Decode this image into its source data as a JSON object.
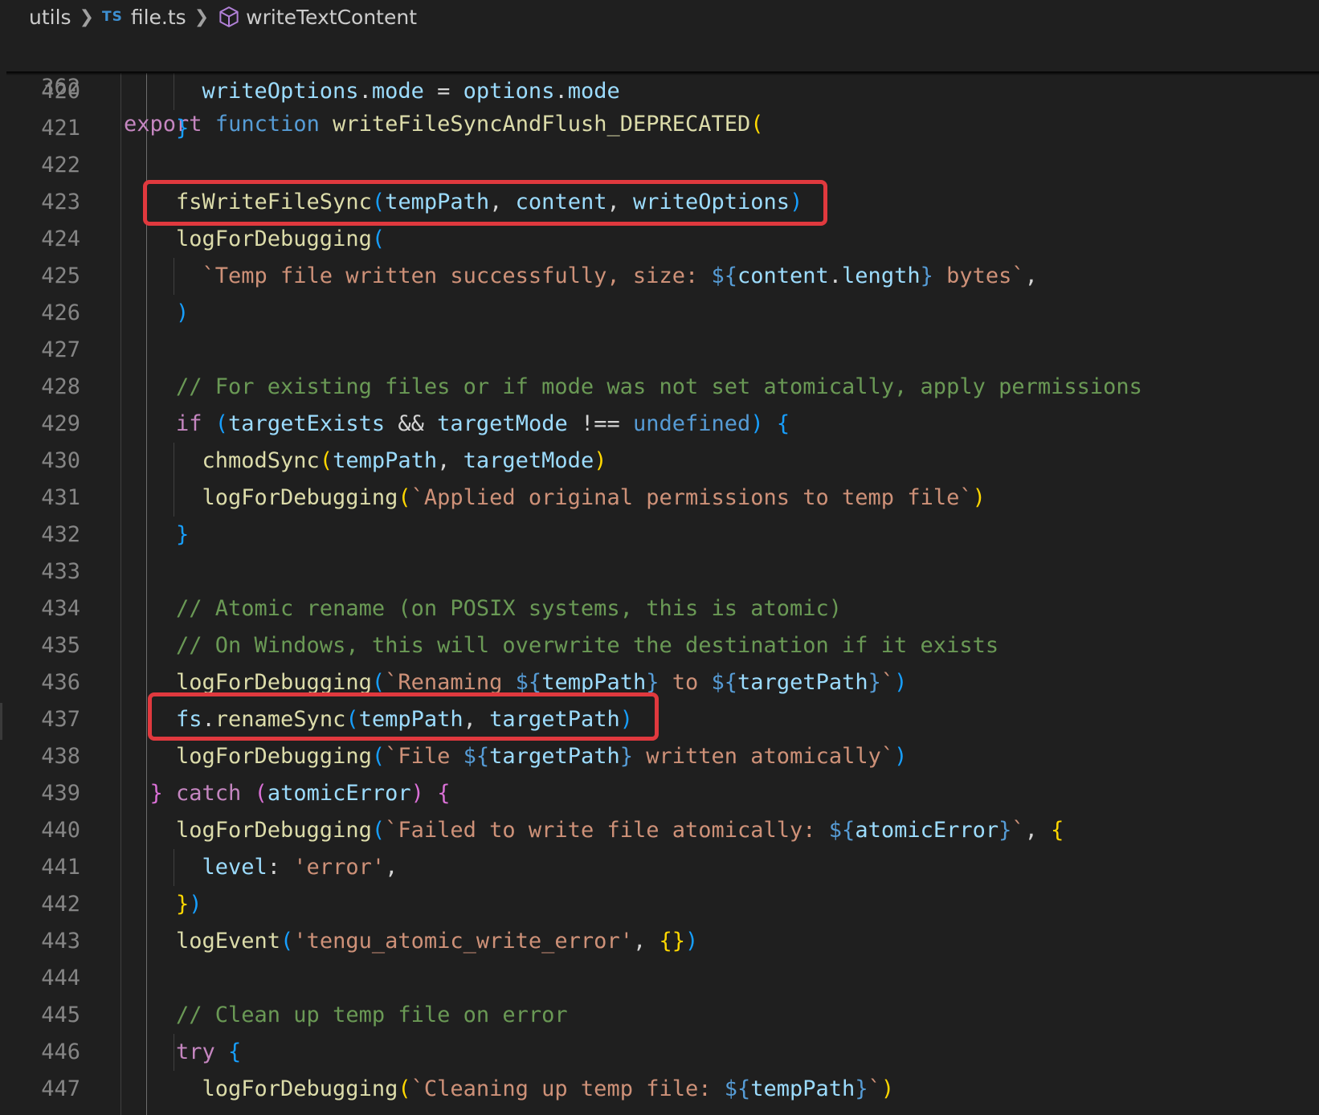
{
  "breadcrumb": {
    "folder": "utils",
    "language_badge": "TS",
    "file": "file.ts",
    "symbol": "writeTextContent"
  },
  "sticky": {
    "line_number": "362",
    "tokens": [
      {
        "t": "export",
        "c": "kw"
      },
      {
        "t": " ",
        "c": "op"
      },
      {
        "t": "function",
        "c": "kw2"
      },
      {
        "t": " ",
        "c": "op"
      },
      {
        "t": "writeFileSyncAndFlush_DEPRECATED",
        "c": "fn"
      },
      {
        "t": "(",
        "c": "p1"
      }
    ]
  },
  "lines": [
    {
      "n": "420",
      "indent": 3,
      "tokens": [
        {
          "t": "writeOptions",
          "c": "var"
        },
        {
          "t": ".",
          "c": "op"
        },
        {
          "t": "mode",
          "c": "prop"
        },
        {
          "t": " = ",
          "c": "op"
        },
        {
          "t": "options",
          "c": "var"
        },
        {
          "t": ".",
          "c": "op"
        },
        {
          "t": "mode",
          "c": "prop"
        }
      ]
    },
    {
      "n": "421",
      "indent": 2,
      "tokens": [
        {
          "t": "}",
          "c": "p3"
        }
      ]
    },
    {
      "n": "422",
      "indent": 0,
      "tokens": []
    },
    {
      "n": "423",
      "indent": 2,
      "tokens": [
        {
          "t": "fsWriteFileSync",
          "c": "fn"
        },
        {
          "t": "(",
          "c": "p3"
        },
        {
          "t": "tempPath",
          "c": "var"
        },
        {
          "t": ", ",
          "c": "op"
        },
        {
          "t": "content",
          "c": "var"
        },
        {
          "t": ", ",
          "c": "op"
        },
        {
          "t": "writeOptions",
          "c": "var"
        },
        {
          "t": ")",
          "c": "p3"
        }
      ]
    },
    {
      "n": "424",
      "indent": 2,
      "tokens": [
        {
          "t": "logForDebugging",
          "c": "fn"
        },
        {
          "t": "(",
          "c": "p3"
        }
      ]
    },
    {
      "n": "425",
      "indent": 3,
      "tokens": [
        {
          "t": "`Temp file written successfully, size: ",
          "c": "str"
        },
        {
          "t": "${",
          "c": "tpl"
        },
        {
          "t": "content",
          "c": "var"
        },
        {
          "t": ".",
          "c": "op"
        },
        {
          "t": "length",
          "c": "prop"
        },
        {
          "t": "}",
          "c": "tpl"
        },
        {
          "t": " bytes`",
          "c": "str"
        },
        {
          "t": ",",
          "c": "op"
        }
      ]
    },
    {
      "n": "426",
      "indent": 2,
      "tokens": [
        {
          "t": ")",
          "c": "p3"
        }
      ]
    },
    {
      "n": "427",
      "indent": 0,
      "tokens": []
    },
    {
      "n": "428",
      "indent": 2,
      "tokens": [
        {
          "t": "// For existing files or if mode was not set atomically, apply permissions",
          "c": "cmt"
        }
      ]
    },
    {
      "n": "429",
      "indent": 2,
      "tokens": [
        {
          "t": "if",
          "c": "kw"
        },
        {
          "t": " ",
          "c": "op"
        },
        {
          "t": "(",
          "c": "p3"
        },
        {
          "t": "targetExists",
          "c": "var"
        },
        {
          "t": " && ",
          "c": "op"
        },
        {
          "t": "targetMode",
          "c": "var"
        },
        {
          "t": " !== ",
          "c": "op"
        },
        {
          "t": "undefined",
          "c": "kw2"
        },
        {
          "t": ")",
          "c": "p3"
        },
        {
          "t": " ",
          "c": "op"
        },
        {
          "t": "{",
          "c": "p3"
        }
      ]
    },
    {
      "n": "430",
      "indent": 3,
      "tokens": [
        {
          "t": "chmodSync",
          "c": "fn"
        },
        {
          "t": "(",
          "c": "p1"
        },
        {
          "t": "tempPath",
          "c": "var"
        },
        {
          "t": ", ",
          "c": "op"
        },
        {
          "t": "targetMode",
          "c": "var"
        },
        {
          "t": ")",
          "c": "p1"
        }
      ]
    },
    {
      "n": "431",
      "indent": 3,
      "tokens": [
        {
          "t": "logForDebugging",
          "c": "fn"
        },
        {
          "t": "(",
          "c": "p1"
        },
        {
          "t": "`Applied original permissions to temp file`",
          "c": "str"
        },
        {
          "t": ")",
          "c": "p1"
        }
      ]
    },
    {
      "n": "432",
      "indent": 2,
      "tokens": [
        {
          "t": "}",
          "c": "p3"
        }
      ]
    },
    {
      "n": "433",
      "indent": 0,
      "tokens": []
    },
    {
      "n": "434",
      "indent": 2,
      "tokens": [
        {
          "t": "// Atomic rename (on POSIX systems, this is atomic)",
          "c": "cmt"
        }
      ]
    },
    {
      "n": "435",
      "indent": 2,
      "tokens": [
        {
          "t": "// On Windows, this will overwrite the destination if it exists",
          "c": "cmt"
        }
      ]
    },
    {
      "n": "436",
      "indent": 2,
      "tokens": [
        {
          "t": "logForDebugging",
          "c": "fn"
        },
        {
          "t": "(",
          "c": "p3"
        },
        {
          "t": "`Renaming ",
          "c": "str"
        },
        {
          "t": "${",
          "c": "tpl"
        },
        {
          "t": "tempPath",
          "c": "var"
        },
        {
          "t": "}",
          "c": "tpl"
        },
        {
          "t": " to ",
          "c": "str"
        },
        {
          "t": "${",
          "c": "tpl"
        },
        {
          "t": "targetPath",
          "c": "var"
        },
        {
          "t": "}",
          "c": "tpl"
        },
        {
          "t": "`",
          "c": "str"
        },
        {
          "t": ")",
          "c": "p3"
        }
      ]
    },
    {
      "n": "437",
      "indent": 2,
      "tokens": [
        {
          "t": "fs",
          "c": "var"
        },
        {
          "t": ".",
          "c": "op"
        },
        {
          "t": "renameSync",
          "c": "fn"
        },
        {
          "t": "(",
          "c": "p3"
        },
        {
          "t": "tempPath",
          "c": "var"
        },
        {
          "t": ", ",
          "c": "op"
        },
        {
          "t": "targetPath",
          "c": "var"
        },
        {
          "t": ")",
          "c": "p3"
        }
      ]
    },
    {
      "n": "438",
      "indent": 2,
      "tokens": [
        {
          "t": "logForDebugging",
          "c": "fn"
        },
        {
          "t": "(",
          "c": "p3"
        },
        {
          "t": "`File ",
          "c": "str"
        },
        {
          "t": "${",
          "c": "tpl"
        },
        {
          "t": "targetPath",
          "c": "var"
        },
        {
          "t": "}",
          "c": "tpl"
        },
        {
          "t": " written atomically`",
          "c": "str"
        },
        {
          "t": ")",
          "c": "p3"
        }
      ]
    },
    {
      "n": "439",
      "indent": 1,
      "tokens": [
        {
          "t": "}",
          "c": "p2"
        },
        {
          "t": " ",
          "c": "op"
        },
        {
          "t": "catch",
          "c": "kw"
        },
        {
          "t": " ",
          "c": "op"
        },
        {
          "t": "(",
          "c": "p2"
        },
        {
          "t": "atomicError",
          "c": "var"
        },
        {
          "t": ")",
          "c": "p2"
        },
        {
          "t": " ",
          "c": "op"
        },
        {
          "t": "{",
          "c": "p2"
        }
      ]
    },
    {
      "n": "440",
      "indent": 2,
      "tokens": [
        {
          "t": "logForDebugging",
          "c": "fn"
        },
        {
          "t": "(",
          "c": "p3"
        },
        {
          "t": "`Failed to write file atomically: ",
          "c": "str"
        },
        {
          "t": "${",
          "c": "tpl"
        },
        {
          "t": "atomicError",
          "c": "var"
        },
        {
          "t": "}",
          "c": "tpl"
        },
        {
          "t": "`",
          "c": "str"
        },
        {
          "t": ", ",
          "c": "op"
        },
        {
          "t": "{",
          "c": "p1"
        }
      ]
    },
    {
      "n": "441",
      "indent": 3,
      "tokens": [
        {
          "t": "level",
          "c": "var"
        },
        {
          "t": ": ",
          "c": "op"
        },
        {
          "t": "'error'",
          "c": "str"
        },
        {
          "t": ",",
          "c": "op"
        }
      ]
    },
    {
      "n": "442",
      "indent": 2,
      "tokens": [
        {
          "t": "}",
          "c": "p1"
        },
        {
          "t": ")",
          "c": "p3"
        }
      ]
    },
    {
      "n": "443",
      "indent": 2,
      "tokens": [
        {
          "t": "logEvent",
          "c": "fn"
        },
        {
          "t": "(",
          "c": "p3"
        },
        {
          "t": "'tengu_atomic_write_error'",
          "c": "str"
        },
        {
          "t": ", ",
          "c": "op"
        },
        {
          "t": "{}",
          "c": "p1"
        },
        {
          "t": ")",
          "c": "p3"
        }
      ]
    },
    {
      "n": "444",
      "indent": 0,
      "tokens": []
    },
    {
      "n": "445",
      "indent": 2,
      "tokens": [
        {
          "t": "// Clean up temp file on error",
          "c": "cmt"
        }
      ]
    },
    {
      "n": "446",
      "indent": 2,
      "tokens": [
        {
          "t": "try",
          "c": "kw"
        },
        {
          "t": " ",
          "c": "op"
        },
        {
          "t": "{",
          "c": "p3"
        }
      ]
    },
    {
      "n": "447",
      "indent": 3,
      "tokens": [
        {
          "t": "logForDebugging",
          "c": "fn"
        },
        {
          "t": "(",
          "c": "p1"
        },
        {
          "t": "`Cleaning up temp file: ",
          "c": "str"
        },
        {
          "t": "${",
          "c": "tpl"
        },
        {
          "t": "tempPath",
          "c": "var"
        },
        {
          "t": "}",
          "c": "tpl"
        },
        {
          "t": "`",
          "c": "str"
        },
        {
          "t": ")",
          "c": "p1"
        }
      ]
    }
  ],
  "highlights": [
    "423",
    "437"
  ]
}
